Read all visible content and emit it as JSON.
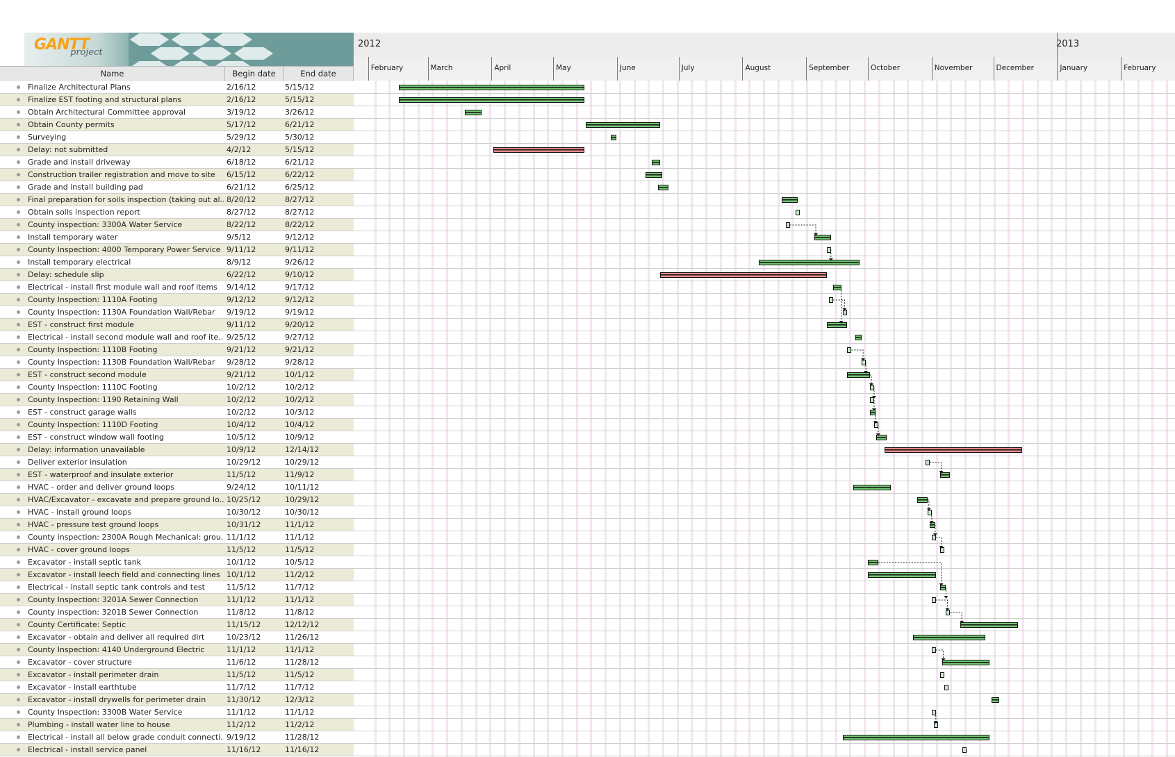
{
  "logo": {
    "main": "GANTT",
    "sub": "project",
    "name": "GanttProject logo"
  },
  "years": [
    "2012",
    "2013"
  ],
  "months": [
    "February",
    "March",
    "April",
    "May",
    "June",
    "July",
    "August",
    "September",
    "October",
    "November",
    "December",
    "January",
    "February"
  ],
  "columns": {
    "name": "Name",
    "begin": "Begin date",
    "end": "End date"
  },
  "colors": {
    "task": "#74c774",
    "delay": "#ea8a8a",
    "header": "#6e9c9a",
    "row_alt": "#ecebd8"
  },
  "tasks": [
    {
      "name": "Finalize Architectural Plans",
      "begin": "2/16/12",
      "end": "5/15/12",
      "type": "task"
    },
    {
      "name": "Finalize EST footing and structural plans",
      "begin": "2/16/12",
      "end": "5/15/12",
      "type": "task"
    },
    {
      "name": "Obtain Architectural Committee approval",
      "begin": "3/19/12",
      "end": "3/26/12",
      "type": "task"
    },
    {
      "name": "Obtain County permits",
      "begin": "5/17/12",
      "end": "6/21/12",
      "type": "task"
    },
    {
      "name": "Surveying",
      "begin": "5/29/12",
      "end": "5/30/12",
      "type": "task"
    },
    {
      "name": "Delay: not submitted",
      "begin": "4/2/12",
      "end": "5/15/12",
      "type": "delay"
    },
    {
      "name": "Grade and install driveway",
      "begin": "6/18/12",
      "end": "6/21/12",
      "type": "task"
    },
    {
      "name": "Construction trailer registration and move to site",
      "begin": "6/15/12",
      "end": "6/22/12",
      "type": "task"
    },
    {
      "name": "Grade and install building pad",
      "begin": "6/21/12",
      "end": "6/25/12",
      "type": "task"
    },
    {
      "name": "Final preparation for soils inspection (taking out al...",
      "begin": "8/20/12",
      "end": "8/27/12",
      "type": "task"
    },
    {
      "name": "Obtain soils inspection report",
      "begin": "8/27/12",
      "end": "8/27/12",
      "type": "task"
    },
    {
      "name": "County inspection: 3300A Water Service",
      "begin": "8/22/12",
      "end": "8/22/12",
      "type": "task"
    },
    {
      "name": "Install temporary water",
      "begin": "9/5/12",
      "end": "9/12/12",
      "type": "task"
    },
    {
      "name": "County Inspection: 4000 Temporary Power Service",
      "begin": "9/11/12",
      "end": "9/11/12",
      "type": "task"
    },
    {
      "name": "Install temporary electrical",
      "begin": "8/9/12",
      "end": "9/26/12",
      "type": "task"
    },
    {
      "name": "Delay: schedule slip",
      "begin": "6/22/12",
      "end": "9/10/12",
      "type": "delay"
    },
    {
      "name": "Electrical - install first module wall and roof items",
      "begin": "9/14/12",
      "end": "9/17/12",
      "type": "task"
    },
    {
      "name": "County Inspection: 1110A Footing",
      "begin": "9/12/12",
      "end": "9/12/12",
      "type": "task"
    },
    {
      "name": "County Inspection: 1130A Foundation Wall/Rebar",
      "begin": "9/19/12",
      "end": "9/19/12",
      "type": "task"
    },
    {
      "name": "EST - construct first module",
      "begin": "9/11/12",
      "end": "9/20/12",
      "type": "task"
    },
    {
      "name": "Electrical - install second module wall and roof ite...",
      "begin": "9/25/12",
      "end": "9/27/12",
      "type": "task"
    },
    {
      "name": "County Inspection: 1110B Footing",
      "begin": "9/21/12",
      "end": "9/21/12",
      "type": "task"
    },
    {
      "name": "County Inspection: 1130B Foundation Wall/Rebar",
      "begin": "9/28/12",
      "end": "9/28/12",
      "type": "task"
    },
    {
      "name": "EST - construct second module",
      "begin": "9/21/12",
      "end": "10/1/12",
      "type": "task"
    },
    {
      "name": "County Inspection: 1110C Footing",
      "begin": "10/2/12",
      "end": "10/2/12",
      "type": "task"
    },
    {
      "name": "County Inspection: 1190 Retaining Wall",
      "begin": "10/2/12",
      "end": "10/2/12",
      "type": "task"
    },
    {
      "name": "EST - construct garage walls",
      "begin": "10/2/12",
      "end": "10/3/12",
      "type": "task"
    },
    {
      "name": "County Inspection: 1110D Footing",
      "begin": "10/4/12",
      "end": "10/4/12",
      "type": "task"
    },
    {
      "name": "EST - construct window wall footing",
      "begin": "10/5/12",
      "end": "10/9/12",
      "type": "task"
    },
    {
      "name": "Delay: information unavailable",
      "begin": "10/9/12",
      "end": "12/14/12",
      "type": "delay"
    },
    {
      "name": "Deliver exterior insulation",
      "begin": "10/29/12",
      "end": "10/29/12",
      "type": "task"
    },
    {
      "name": "EST - waterproof and insulate exterior",
      "begin": "11/5/12",
      "end": "11/9/12",
      "type": "task"
    },
    {
      "name": "HVAC - order and deliver ground loops",
      "begin": "9/24/12",
      "end": "10/11/12",
      "type": "task"
    },
    {
      "name": "HVAC/Excavator - excavate and prepare ground lo...",
      "begin": "10/25/12",
      "end": "10/29/12",
      "type": "task"
    },
    {
      "name": "HVAC - install ground loops",
      "begin": "10/30/12",
      "end": "10/30/12",
      "type": "task"
    },
    {
      "name": "HVAC - pressure test ground loops",
      "begin": "10/31/12",
      "end": "11/1/12",
      "type": "task"
    },
    {
      "name": "County inspection: 2300A Rough Mechanical: grou...",
      "begin": "11/1/12",
      "end": "11/1/12",
      "type": "task"
    },
    {
      "name": "HVAC - cover ground loops",
      "begin": "11/5/12",
      "end": "11/5/12",
      "type": "task"
    },
    {
      "name": "Excavator - install septic tank",
      "begin": "10/1/12",
      "end": "10/5/12",
      "type": "task"
    },
    {
      "name": "Excavator - install leech field and connecting lines",
      "begin": "10/1/12",
      "end": "11/2/12",
      "type": "task"
    },
    {
      "name": "Electrical - install septic tank controls and test",
      "begin": "11/5/12",
      "end": "11/7/12",
      "type": "task"
    },
    {
      "name": "County Inspection: 3201A Sewer Connection",
      "begin": "11/1/12",
      "end": "11/1/12",
      "type": "task"
    },
    {
      "name": "County inspection: 3201B Sewer Connection",
      "begin": "11/8/12",
      "end": "11/8/12",
      "type": "task"
    },
    {
      "name": "County Certificate: Septic",
      "begin": "11/15/12",
      "end": "12/12/12",
      "type": "task"
    },
    {
      "name": "Excavator - obtain and deliver all required dirt",
      "begin": "10/23/12",
      "end": "11/26/12",
      "type": "task"
    },
    {
      "name": "County Inspection: 4140 Underground Electric",
      "begin": "11/1/12",
      "end": "11/1/12",
      "type": "task"
    },
    {
      "name": "Excavator - cover structure",
      "begin": "11/6/12",
      "end": "11/28/12",
      "type": "task"
    },
    {
      "name": "Excavator - install perimeter drain",
      "begin": "11/5/12",
      "end": "11/5/12",
      "type": "task"
    },
    {
      "name": "Excavator - install earthtube",
      "begin": "11/7/12",
      "end": "11/7/12",
      "type": "task"
    },
    {
      "name": "Excavator - install drywells for perimeter drain",
      "begin": "11/30/12",
      "end": "12/3/12",
      "type": "task"
    },
    {
      "name": "County Inspection: 3300B Water Service",
      "begin": "11/1/12",
      "end": "11/1/12",
      "type": "task"
    },
    {
      "name": "Plumbing - install water line to house",
      "begin": "11/2/12",
      "end": "11/2/12",
      "type": "task"
    },
    {
      "name": "Electrical - install all below grade conduit connecti...",
      "begin": "9/19/12",
      "end": "11/28/12",
      "type": "task"
    },
    {
      "name": "Electrical - install service panel",
      "begin": "11/16/12",
      "end": "11/16/12",
      "type": "task"
    }
  ]
}
